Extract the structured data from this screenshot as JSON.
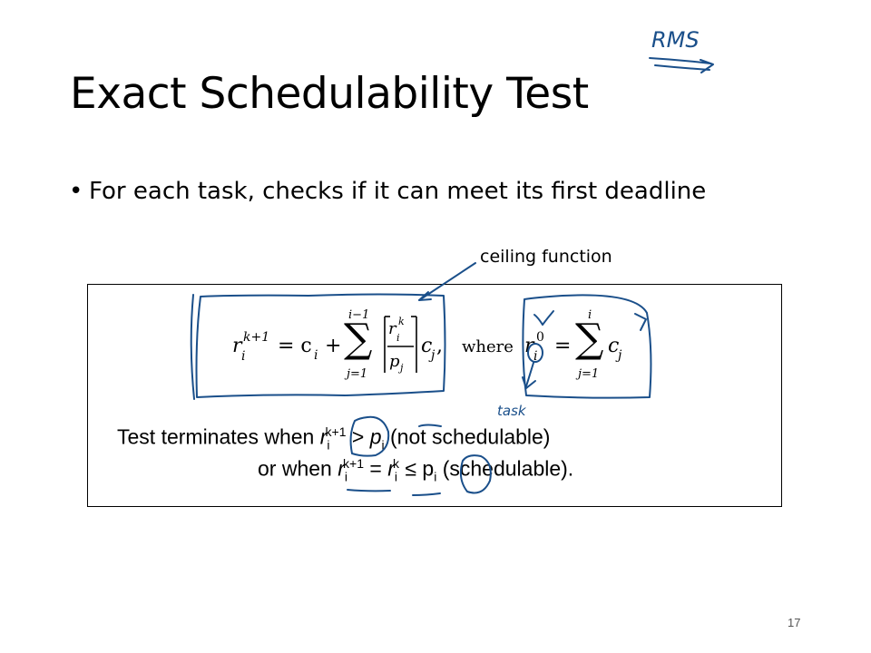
{
  "slide": {
    "title": "Exact Schedulability Test",
    "bullet": "For each task, checks if it can meet its first deadline",
    "annotation_ceiling": "ceiling function",
    "page_number": "17"
  },
  "formula": {
    "r": "r",
    "eq_sub": "i",
    "eq_sup": "k+1",
    "eq": "= c",
    "plus": "+",
    "sum_upper": "i−1",
    "sum_lower": "j=1",
    "frac_num": "r",
    "frac_num_sub": "i",
    "frac_num_sup": "k",
    "frac_den": "p",
    "frac_den_sub": "j",
    "after_frac": "c",
    "after_frac_sub": "j",
    "comma": ",",
    "where": "where",
    "r0_sup": "0",
    "sum2_upper": "i",
    "sum2_lower": "j=1",
    "sum2_term": "c",
    "sum2_term_sub": "j"
  },
  "termination": {
    "line1_prefix": "Test terminates when ",
    "line1_r": "r",
    "line1_sub": "i",
    "line1_sup": "k+1",
    "line1_gt": " > ",
    "line1_p": "p",
    "line1_psub": "i",
    "line1_suffix": " (not schedulable)",
    "line2_prefix": "or  when ",
    "line2_r": "r",
    "line2_sub": "i",
    "line2_sup": "k+1",
    "line2_eq": " = ",
    "line2_r2": "r",
    "line2_sub2": "i",
    "line2_sup2": "k",
    "line2_le": " ≤ ",
    "line2_p": "p",
    "line2_psub": "i",
    "line2_suffix": " (schedulable)."
  },
  "handwriting": {
    "rms": "RMS",
    "task": "task",
    "ink_color": "#1a4f8a"
  }
}
